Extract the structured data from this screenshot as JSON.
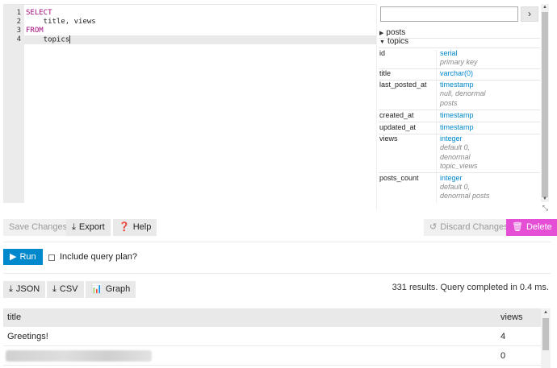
{
  "editor": {
    "line_numbers": [
      "1",
      "2",
      "3",
      "4"
    ],
    "lines": [
      {
        "keyword": "SELECT",
        "text": ""
      },
      {
        "keyword": "",
        "text": "    title, views"
      },
      {
        "keyword": "FROM",
        "text": ""
      },
      {
        "keyword": "",
        "text": "    topics"
      }
    ]
  },
  "schema": {
    "search_placeholder": "",
    "go_label": "›",
    "tables": [
      {
        "name": "posts",
        "expanded": false
      },
      {
        "name": "topics",
        "expanded": true
      }
    ],
    "columns": [
      {
        "name": "id",
        "type": "serial",
        "notes": [
          "primary key"
        ]
      },
      {
        "name": "title",
        "type": "varchar(0)",
        "notes": []
      },
      {
        "name": "last_posted_at",
        "type": "timestamp",
        "notes": [
          "null, denormal",
          "posts"
        ]
      },
      {
        "name": "created_at",
        "type": "timestamp",
        "notes": []
      },
      {
        "name": "updated_at",
        "type": "timestamp",
        "notes": []
      },
      {
        "name": "views",
        "type": "integer",
        "notes": [
          "default 0,",
          "denormal",
          "topic_views"
        ]
      },
      {
        "name": "posts_count",
        "type": "integer",
        "notes": [
          "default 0,",
          "denormal posts"
        ]
      }
    ]
  },
  "toolbar": {
    "save_label": "Save Changes",
    "export_label": "Export",
    "help_label": "Help",
    "discard_label": "Discard Changes",
    "delete_label": "Delete"
  },
  "run": {
    "run_label": "Run",
    "include_plan_label": "Include query plan?"
  },
  "results_toolbar": {
    "json_label": "JSON",
    "csv_label": "CSV",
    "graph_label": "Graph",
    "info": "331 results. Query completed in 0.4 ms."
  },
  "results": {
    "headers": [
      "title",
      "views"
    ],
    "rows": [
      {
        "title": "Greetings!",
        "views": "4"
      },
      {
        "title": "",
        "views": "0"
      }
    ]
  },
  "colors": {
    "primary": "#0088cc",
    "danger": "#e44fd5",
    "keyword": "#a00b7d",
    "type_link": "#0088cc"
  }
}
